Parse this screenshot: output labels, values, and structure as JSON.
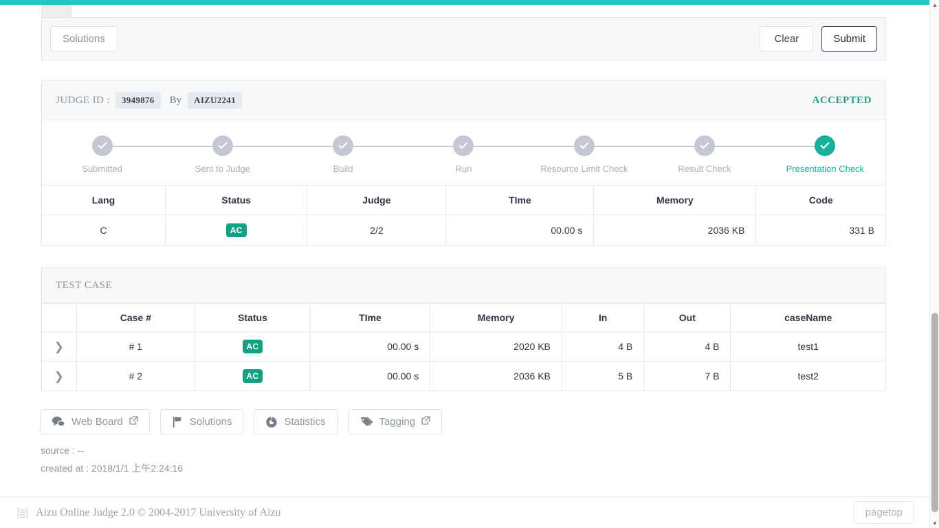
{
  "topbar": {
    "accent_color": "#26c6c0"
  },
  "submit_panel": {
    "solutions_label": "Solutions",
    "clear_label": "Clear",
    "submit_label": "Submit"
  },
  "judge": {
    "id_label": "JUDGE ID :",
    "id_value": "3949876",
    "by_label": "By",
    "user": "AIZU2241",
    "verdict": "ACCEPTED",
    "verdict_color": "#279e85",
    "steps": [
      {
        "label": "Submitted",
        "done": false
      },
      {
        "label": "Sent to Judge",
        "done": false
      },
      {
        "label": "Build",
        "done": false
      },
      {
        "label": "Run",
        "done": false
      },
      {
        "label": "Resource Limit Check",
        "done": false
      },
      {
        "label": "Result Check",
        "done": false
      },
      {
        "label": "Presentation Check",
        "done": true
      }
    ],
    "summary_headers": [
      "Lang",
      "Status",
      "Judge",
      "TIme",
      "Memory",
      "Code"
    ],
    "summary_values": {
      "lang": "C",
      "status": "AC",
      "judge": "2/2",
      "time": "00.00 s",
      "memory": "2036 KB",
      "code": "331 B"
    }
  },
  "test_case": {
    "title": "TEST CASE",
    "headers": [
      "",
      "Case #",
      "Status",
      "TIme",
      "Memory",
      "In",
      "Out",
      "caseName"
    ],
    "rows": [
      {
        "case": "# 1",
        "status": "AC",
        "time": "00.00 s",
        "memory": "2020 KB",
        "in": "4 B",
        "out": "4 B",
        "name": "test1"
      },
      {
        "case": "# 2",
        "status": "AC",
        "time": "00.00 s",
        "memory": "2036 KB",
        "in": "5 B",
        "out": "7 B",
        "name": "test2"
      }
    ]
  },
  "links": [
    {
      "label": "Web Board",
      "icon": "comments-icon",
      "external": true
    },
    {
      "label": "Solutions",
      "icon": "flag-icon",
      "external": false
    },
    {
      "label": "Statistics",
      "icon": "pie-chart-icon",
      "external": false
    },
    {
      "label": "Tagging",
      "icon": "tags-icon",
      "external": true
    }
  ],
  "meta": {
    "source": "source : --",
    "created": "created at : 2018/1/1 上午2:24:16"
  },
  "footer": {
    "text": "Aizu Online Judge 2.0 © 2004-2017 University of Aizu",
    "pagetop_label": "pagetop"
  },
  "colors": {
    "accent": "#26c6c0",
    "ac_badge": "#13a184",
    "step_done": "#16b198"
  }
}
